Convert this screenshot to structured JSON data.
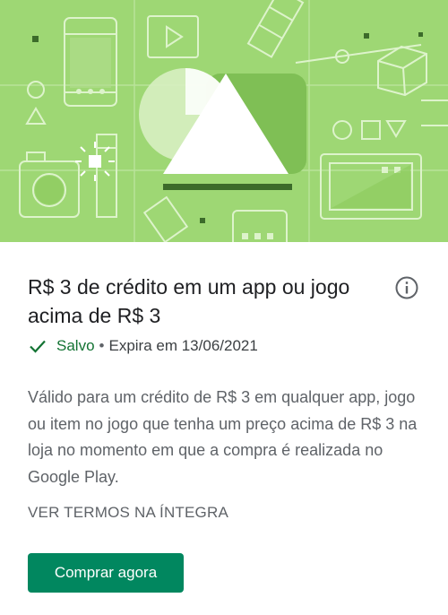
{
  "offer": {
    "title": "R$ 3 de crédito em um app ou jogo acima de R$ 3",
    "info_icon": "info-outline-icon",
    "status": {
      "check_icon": "check-icon",
      "saved_label": "Salvo",
      "separator": "•",
      "expiry": "Expira em 13/06/2021"
    },
    "description": "Válido para um crédito de R$ 3 em qualquer app, jogo ou item no jogo que tenha um preço acima de R$ 3 na loja no momento em que a compra é realizada no Google Play.",
    "terms_link": "VER TERMOS NA ÍNTEGRA",
    "buy_button": "Comprar agora"
  },
  "hero": {
    "illustration": "google-play-triangle-illustration"
  },
  "colors": {
    "hero_bg": "#9ed774",
    "accent_green": "#01875f",
    "saved_green": "#137333",
    "body_text": "#5f6368"
  }
}
